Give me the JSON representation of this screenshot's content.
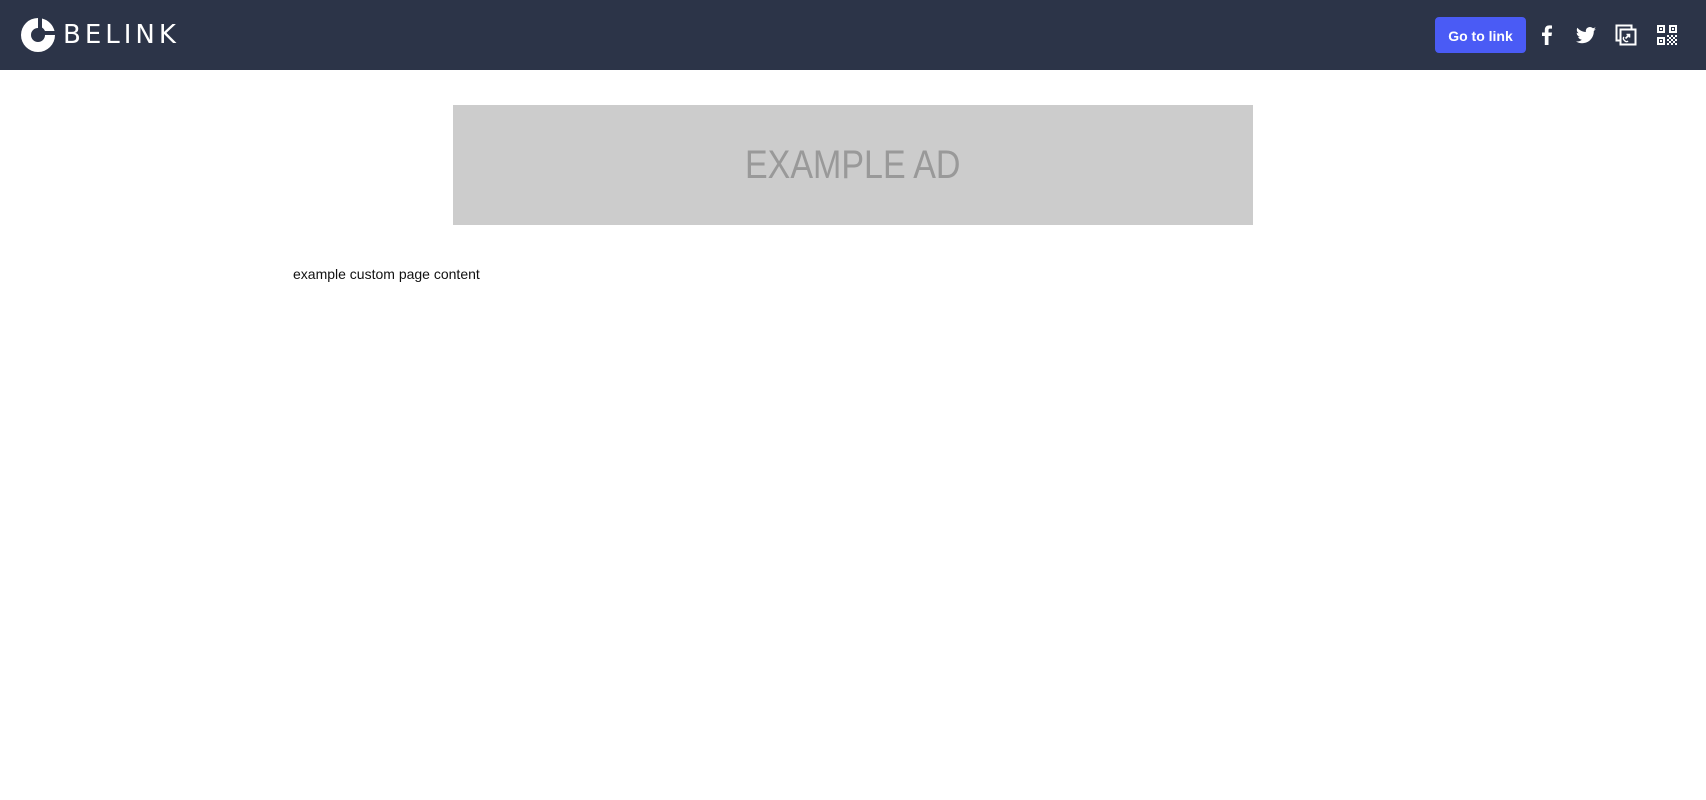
{
  "header": {
    "brand": "BELINK",
    "logo_icon": "belink-logo-icon",
    "go_to_link_label": "Go to link",
    "share_icons": [
      "facebook-icon",
      "twitter-icon",
      "copy-link-icon",
      "qr-code-icon"
    ],
    "background_color": "#2c3448",
    "button_color": "#4a5bf5"
  },
  "ad": {
    "text": "EXAMPLE AD",
    "background_color": "#cccccc"
  },
  "content": {
    "text": "example custom page content"
  }
}
